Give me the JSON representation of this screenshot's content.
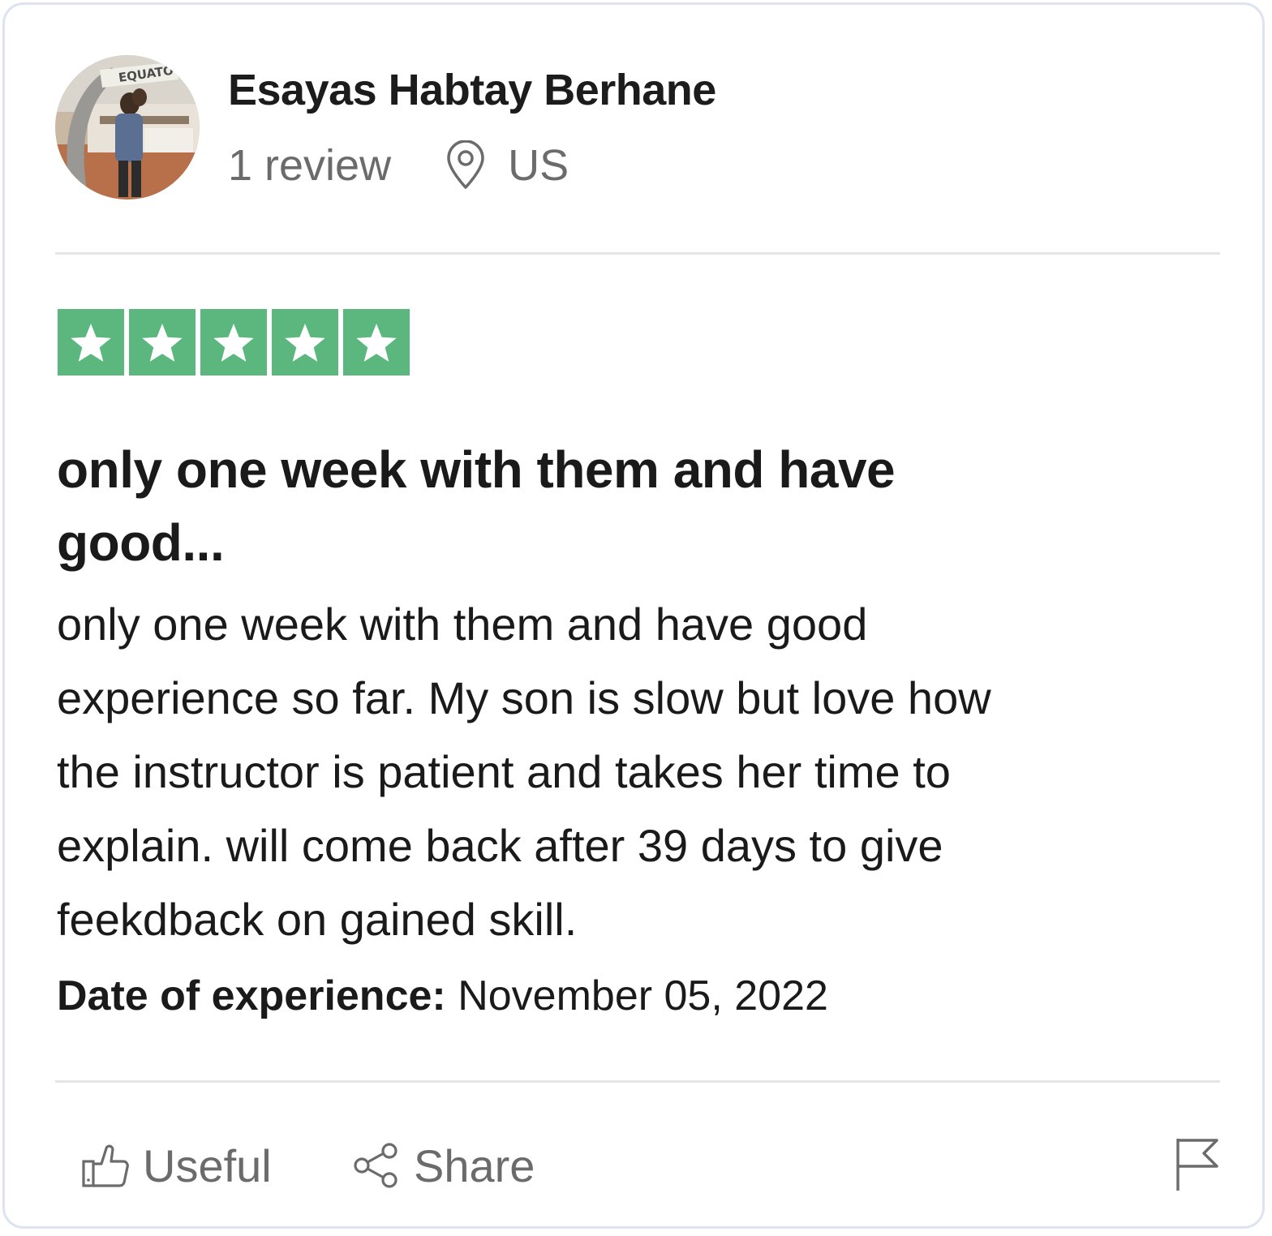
{
  "reviewer": {
    "name": "Esayas Habtay Berhane",
    "review_count": "1 review",
    "country": "US",
    "avatar_icon": "user-photo-avatar",
    "avatar_sign_text": "EQUATO"
  },
  "rating": {
    "stars": 5,
    "max": 5,
    "star_color": "#5bb77e",
    "icon": "star-icon"
  },
  "review": {
    "title_lines": [
      "only one week with them and have",
      "good..."
    ],
    "body_lines": [
      "only one week with them and have good",
      "experience so far. My son is slow but love how",
      "the instructor is patient and takes her time to",
      "explain. will come back after 39 days to give",
      "feekdback on gained skill."
    ],
    "date_label": "Date of experience:",
    "date_value": "November 05, 2022"
  },
  "actions": {
    "useful_label": "Useful",
    "useful_icon": "thumbs-up-icon",
    "share_label": "Share",
    "share_icon": "share-icon",
    "report_icon": "flag-icon"
  },
  "colors": {
    "text": "#1a1a1a",
    "muted": "#6b6b6b",
    "divider": "#e5e5e5",
    "card_border": "#dde3f2"
  }
}
